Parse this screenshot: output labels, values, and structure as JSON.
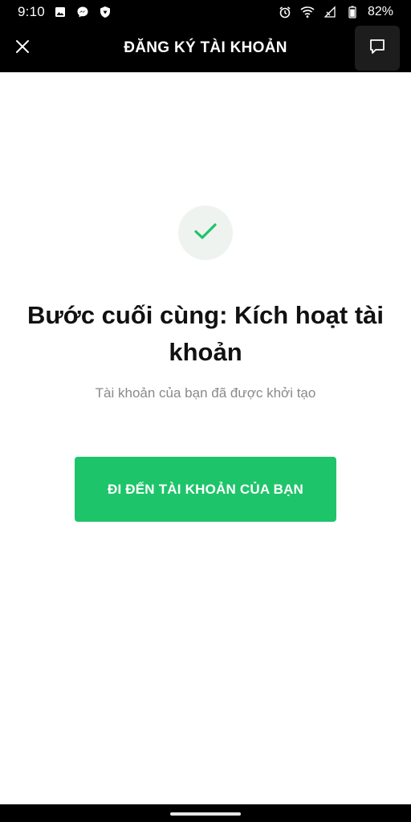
{
  "status_bar": {
    "time": "9:10",
    "battery": "82%",
    "icons": [
      "image-icon",
      "messenger-icon",
      "shield-icon",
      "alarm-icon",
      "wifi-icon",
      "signal-icon",
      "battery-icon"
    ]
  },
  "header": {
    "title": "ĐĂNG KÝ TÀI KHOẢN",
    "close_icon": "close-icon",
    "chat_icon": "chat-icon"
  },
  "content": {
    "check_icon": "check-icon",
    "title": "Bước cuối cùng: Kích hoạt tài khoản",
    "subtitle": "Tài khoản của bạn đã được khởi tạo",
    "primary_button": "ĐI ĐẾN TÀI KHOẢN CỦA BẠN"
  },
  "colors": {
    "accent": "#1ec46a",
    "header_bg": "#000000",
    "check_bg": "#eef3f0",
    "text_primary": "#111111",
    "text_secondary": "#8a8a8a"
  }
}
